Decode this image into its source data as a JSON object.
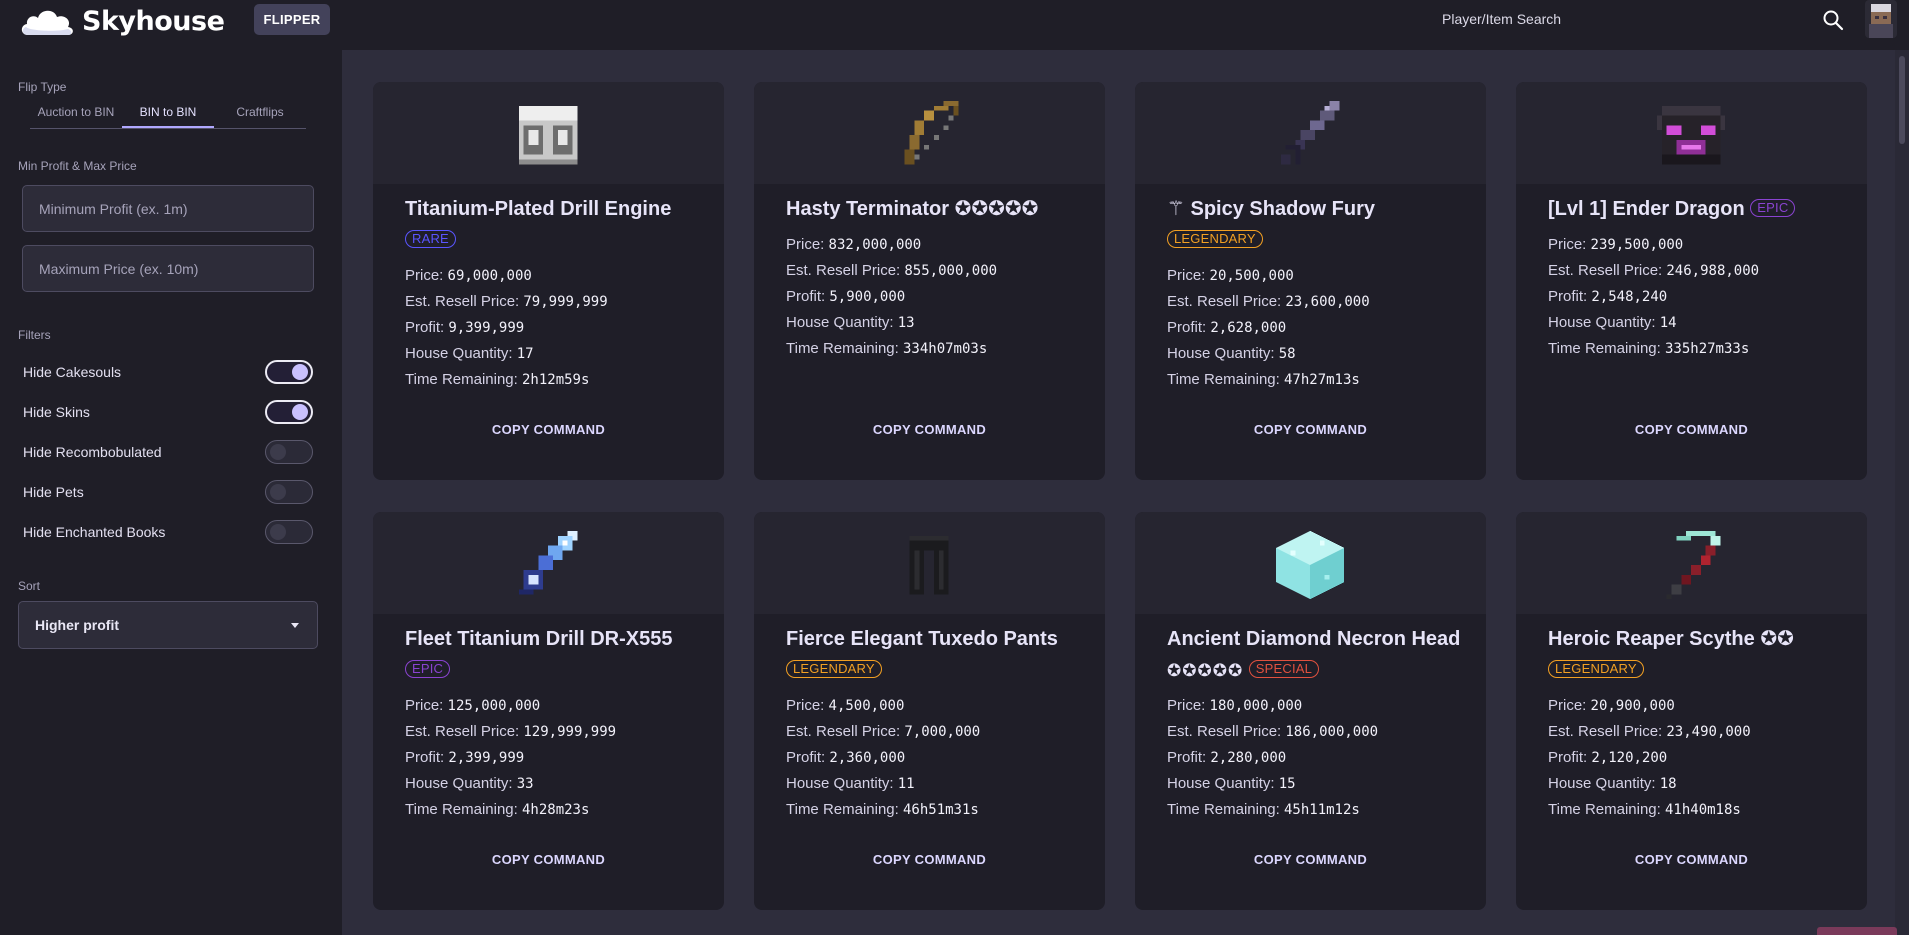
{
  "header": {
    "brand": "Skyhouse",
    "flipper_button": "FLIPPER",
    "search_label": "Player/Item Search"
  },
  "sidebar": {
    "flip_type_label": "Flip Type",
    "tabs": [
      "Auction to BIN",
      "BIN to BIN",
      "Craftflips"
    ],
    "active_tab": "BIN to BIN",
    "price_section_label": "Min Profit & Max Price",
    "min_profit_placeholder": "Minimum Profit (ex. 1m)",
    "max_price_placeholder": "Maximum Price (ex. 10m)",
    "filters_label": "Filters",
    "filters": [
      {
        "label": "Hide Cakesouls",
        "on": true
      },
      {
        "label": "Hide Skins",
        "on": true
      },
      {
        "label": "Hide Recombobulated",
        "on": false
      },
      {
        "label": "Hide Pets",
        "on": false
      },
      {
        "label": "Hide Enchanted Books",
        "on": false
      }
    ],
    "sort_label": "Sort",
    "sort_value": "Higher profit"
  },
  "labels": {
    "price": "Price: ",
    "resell": "Est. Resell Price: ",
    "profit": "Profit: ",
    "quantity": "House Quantity: ",
    "time": "Time Remaining: ",
    "copy": "COPY COMMAND"
  },
  "cards": [
    {
      "title": "Titanium-Plated Drill Engine",
      "stars": "",
      "rarity": "RARE",
      "price": "69,000,000",
      "resell": "79,999,999",
      "profit": "9,399,999",
      "quantity": "17",
      "time": "2h12m59s",
      "icon": "drill-engine-icon"
    },
    {
      "title": "Hasty Terminator ✪✪✪✪✪",
      "stars": "",
      "rarity": "",
      "price": "832,000,000",
      "resell": "855,000,000",
      "profit": "5,900,000",
      "quantity": "13",
      "time": "334h07m03s",
      "icon": "bow-icon"
    },
    {
      "title": "⚚ Spicy Shadow Fury",
      "stars": "",
      "rarity": "LEGENDARY",
      "price": "20,500,000",
      "resell": "23,600,000",
      "profit": "2,628,000",
      "quantity": "58",
      "time": "47h27m13s",
      "icon": "sword-icon"
    },
    {
      "title": "[Lvl 1] Ender Dragon",
      "stars": "",
      "rarity": "EPIC",
      "price": "239,500,000",
      "resell": "246,988,000",
      "profit": "2,548,240",
      "quantity": "14",
      "time": "335h27m33s",
      "icon": "dragon-head-icon"
    },
    {
      "title": "Fleet Titanium Drill DR-X555",
      "stars": "",
      "rarity": "EPIC",
      "price": "125,000,000",
      "resell": "129,999,999",
      "profit": "2,399,999",
      "quantity": "33",
      "time": "4h28m23s",
      "icon": "drill-icon"
    },
    {
      "title": "Fierce Elegant Tuxedo Pants",
      "stars": "",
      "rarity": "LEGENDARY",
      "price": "4,500,000",
      "resell": "7,000,000",
      "profit": "2,360,000",
      "quantity": "11",
      "time": "46h51m31s",
      "icon": "pants-icon"
    },
    {
      "title": "Ancient Diamond Necron Head",
      "stars": "✪✪✪✪✪",
      "rarity": "SPECIAL",
      "price": "180,000,000",
      "resell": "186,000,000",
      "profit": "2,280,000",
      "quantity": "15",
      "time": "45h11m12s",
      "icon": "diamond-head-icon"
    },
    {
      "title": "Heroic Reaper Scythe ✪✪",
      "stars": "",
      "rarity": "LEGENDARY",
      "price": "20,900,000",
      "resell": "23,490,000",
      "profit": "2,120,200",
      "quantity": "18",
      "time": "41h40m18s",
      "icon": "scythe-icon"
    }
  ],
  "colors": {
    "background": "#2e2d3c",
    "panel": "#1f1e27",
    "accent": "#b0a8ff",
    "rare": "#5a55ff",
    "epic": "#8a43d0",
    "legendary": "#f2a023",
    "special": "#e1513f"
  }
}
